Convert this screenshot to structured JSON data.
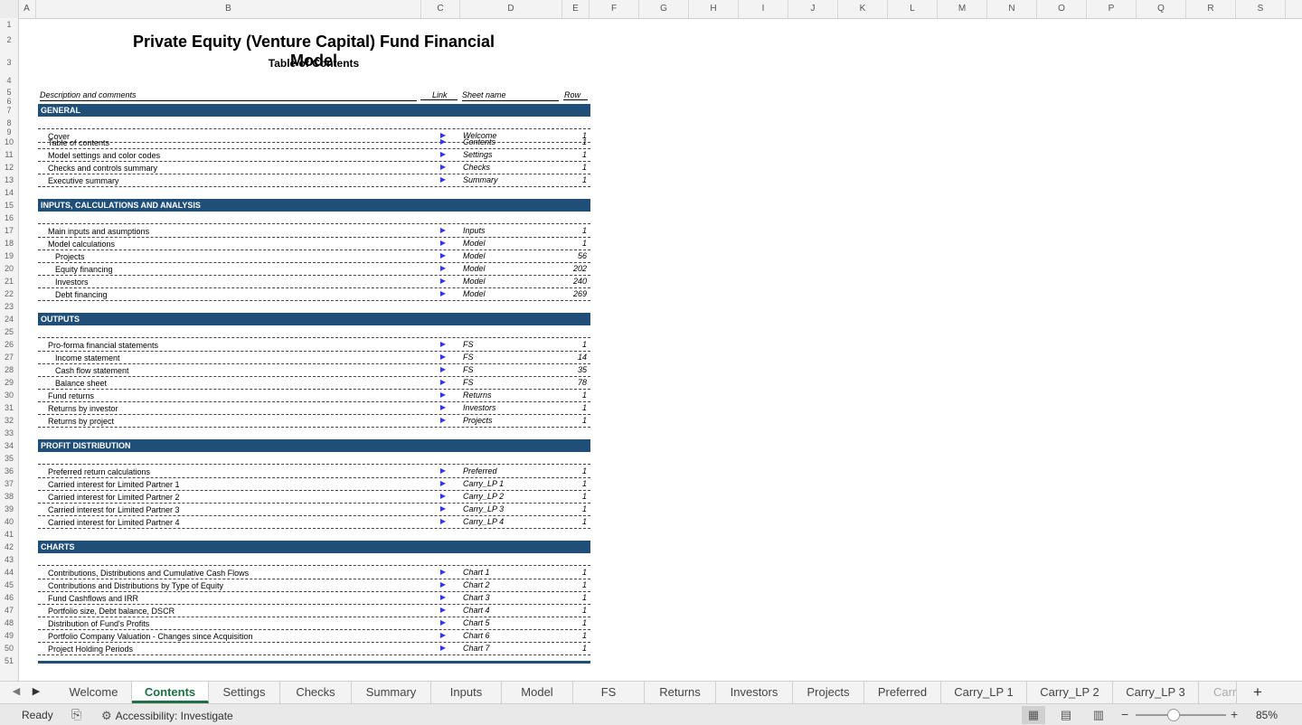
{
  "columns": [
    "A",
    "B",
    "C",
    "D",
    "E",
    "F",
    "G",
    "H",
    "I",
    "J",
    "K",
    "L",
    "M",
    "N",
    "O",
    "P",
    "Q",
    "R",
    "S"
  ],
  "row_numbers": [
    "1",
    "2",
    "3",
    "4",
    "5",
    "6",
    "7",
    "8",
    "9",
    "10",
    "11",
    "12",
    "13",
    "14",
    "15",
    "16",
    "17",
    "18",
    "19",
    "20",
    "21",
    "22",
    "23",
    "24",
    "25",
    "26",
    "27",
    "28",
    "29",
    "30",
    "31",
    "32",
    "33",
    "34",
    "35",
    "36",
    "37",
    "38",
    "39",
    "40",
    "41",
    "42",
    "43",
    "44",
    "45",
    "46",
    "47",
    "48",
    "49",
    "50",
    "51"
  ],
  "sheet": {
    "title": "Private Equity (Venture Capital) Fund Financial Model",
    "subtitle": "Table of Contents",
    "header": {
      "description": "Description and comments",
      "link": "Link",
      "sheet_name": "Sheet name",
      "row": "Row"
    },
    "link_glyph": "▶",
    "sections": [
      {
        "label": "GENERAL",
        "items": [
          {
            "desc": "Cover",
            "sheet": "Welcome",
            "row": "1"
          },
          {
            "desc": "Table of contents",
            "sheet": "Contents",
            "row": "1"
          },
          {
            "desc": "Model settings and color codes",
            "sheet": "Settings",
            "row": "1"
          },
          {
            "desc": "Checks and controls summary",
            "sheet": "Checks",
            "row": "1"
          },
          {
            "desc": "Executive summary",
            "sheet": "Summary",
            "row": "1"
          }
        ]
      },
      {
        "label": "INPUTS, CALCULATIONS AND ANALYSIS",
        "items": [
          {
            "desc": "Main inputs and asumptions",
            "sheet": "Inputs",
            "row": "1"
          },
          {
            "desc": "Model calculations",
            "sheet": "Model",
            "row": "1"
          },
          {
            "desc": "Projects",
            "sheet": "Model",
            "row": "56",
            "indent": true
          },
          {
            "desc": "Equity financing",
            "sheet": "Model",
            "row": "202",
            "indent": true
          },
          {
            "desc": "Investors",
            "sheet": "Model",
            "row": "240",
            "indent": true
          },
          {
            "desc": "Debt financing",
            "sheet": "Model",
            "row": "269",
            "indent": true
          }
        ]
      },
      {
        "label": "OUTPUTS",
        "items": [
          {
            "desc": "Pro-forma financial statements",
            "sheet": "FS",
            "row": "1"
          },
          {
            "desc": "Income statement",
            "sheet": "FS",
            "row": "14",
            "indent": true
          },
          {
            "desc": "Cash flow statement",
            "sheet": "FS",
            "row": "35",
            "indent": true
          },
          {
            "desc": "Balance sheet",
            "sheet": "FS",
            "row": "78",
            "indent": true
          },
          {
            "desc": "Fund returns",
            "sheet": "Returns",
            "row": "1"
          },
          {
            "desc": "Returns by investor",
            "sheet": "Investors",
            "row": "1"
          },
          {
            "desc": "Returns by project",
            "sheet": "Projects",
            "row": "1"
          }
        ]
      },
      {
        "label": "PROFIT DISTRIBUTION",
        "items": [
          {
            "desc": "Preferred return calculations",
            "sheet": "Preferred",
            "row": "1"
          },
          {
            "desc": "Carried interest for Limited Partner 1",
            "sheet": "Carry_LP 1",
            "row": "1"
          },
          {
            "desc": "Carried interest for Limited Partner 2",
            "sheet": "Carry_LP 2",
            "row": "1"
          },
          {
            "desc": "Carried interest for Limited Partner 3",
            "sheet": "Carry_LP 3",
            "row": "1"
          },
          {
            "desc": "Carried interest for Limited Partner 4",
            "sheet": "Carry_LP 4",
            "row": "1"
          }
        ]
      },
      {
        "label": "CHARTS",
        "items": [
          {
            "desc": "Contributions, Distributions and Cumulative Cash Flows",
            "sheet": "Chart 1",
            "row": "1"
          },
          {
            "desc": "Contributions and Distributions by Type of Equity",
            "sheet": "Chart 2",
            "row": "1"
          },
          {
            "desc": "Fund Cashflows and IRR",
            "sheet": "Chart 3",
            "row": "1"
          },
          {
            "desc": "Portfolio size, Debt balance, DSCR",
            "sheet": "Chart 4",
            "row": "1"
          },
          {
            "desc": "Distribution of Fund's Profits",
            "sheet": "Chart 5",
            "row": "1"
          },
          {
            "desc": "Portfolio Company Valuation - Changes since Acquisition",
            "sheet": "Chart 6",
            "row": "1"
          },
          {
            "desc": "Project Holding Periods",
            "sheet": "Chart 7",
            "row": "1"
          }
        ]
      }
    ]
  },
  "tabs": {
    "nav_prev_icon": "◀",
    "nav_next_icon": "▶",
    "items": [
      "Welcome",
      "Contents",
      "Settings",
      "Checks",
      "Summary",
      "Inputs",
      "Model",
      "FS",
      "Returns",
      "Investors",
      "Projects",
      "Preferred",
      "Carry_LP 1",
      "Carry_LP 2",
      "Carry_LP 3",
      "Carr"
    ],
    "active": "Contents",
    "add_icon": "+"
  },
  "status": {
    "ready": "Ready",
    "accessibility": "Accessibility: Investigate",
    "zoom_out": "−",
    "zoom_in": "+",
    "zoom": "85%"
  },
  "colors": {
    "section_fill": "#1f4e79",
    "active_tab": "#1e7145",
    "link_arrow": "#3333ff"
  }
}
